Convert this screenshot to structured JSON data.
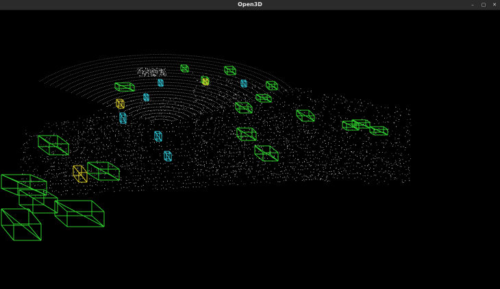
{
  "window": {
    "title": "Open3D",
    "controls": [
      {
        "name": "minimize",
        "glyph": "–"
      },
      {
        "name": "maximize",
        "glyph": "▢"
      },
      {
        "name": "close",
        "glyph": "✕"
      }
    ]
  },
  "colors": {
    "background": "#000000",
    "points": "#e8e8e8",
    "box_car": "#2fd12f",
    "box_pedestrian": "#2fc6d6",
    "box_cyclist": "#d6c62a"
  }
}
